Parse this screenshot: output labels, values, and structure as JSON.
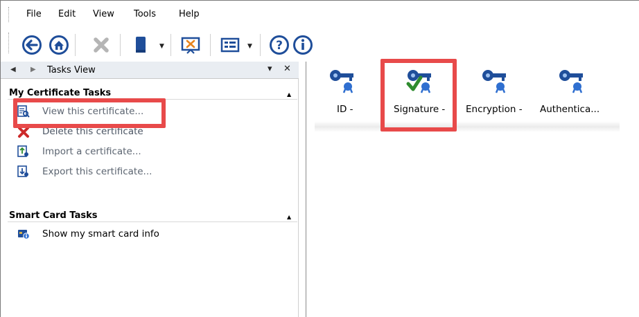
{
  "menu": {
    "items": [
      "File",
      "Edit",
      "View",
      "Tools",
      "Help"
    ]
  },
  "toolbar": {
    "buttons": [
      "back-icon",
      "home-icon",
      "delete-icon",
      "card-reader-icon",
      "presentation-icon",
      "details-view-icon",
      "help-icon",
      "info-icon"
    ]
  },
  "tasks_view": {
    "title": "Tasks View",
    "close_label": "✕",
    "menu_label": "▾"
  },
  "certificate_tasks": {
    "title": "My Certificate Tasks",
    "items": [
      {
        "label": "View this certificate...",
        "icon": "view-certificate-icon"
      },
      {
        "label": "Delete this certificate",
        "icon": "delete-certificate-icon"
      },
      {
        "label": "Import a certificate...",
        "icon": "import-certificate-icon"
      },
      {
        "label": "Export this certificate...",
        "icon": "export-certificate-icon"
      }
    ]
  },
  "smart_card_tasks": {
    "title": "Smart Card Tasks",
    "items": [
      {
        "label": "Show my smart card info",
        "icon": "smart-card-info-icon"
      }
    ]
  },
  "certificates": [
    {
      "label": "ID -",
      "icon": "key-certificate-icon"
    },
    {
      "label": "Signature -",
      "icon": "key-certificate-checked-icon"
    },
    {
      "label": "Encryption -",
      "icon": "key-certificate-icon"
    },
    {
      "label": "Authentica...",
      "icon": "key-certificate-icon"
    }
  ],
  "colors": {
    "highlight": "#e84a4a",
    "accent": "#1f4e9a",
    "check": "#2e8b2e"
  }
}
